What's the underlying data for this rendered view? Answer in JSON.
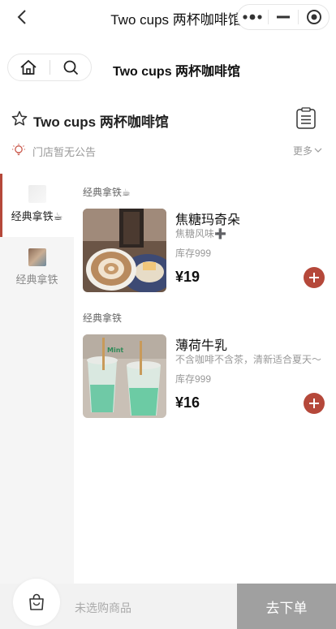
{
  "navbar": {
    "title": "Two cups 两杯咖啡馆"
  },
  "subheader": {
    "title": "Two cups 两杯咖啡馆"
  },
  "store": {
    "name": "Two cups 两杯咖啡馆",
    "notice": "门店暂无公告",
    "more_label": "更多"
  },
  "sidebar": {
    "items": [
      {
        "label": "经典拿铁☕",
        "active": true
      },
      {
        "label": "经典拿铁",
        "active": false
      }
    ]
  },
  "sections": [
    {
      "title": "经典拿铁☕",
      "product": {
        "name": "焦糖玛奇朵",
        "desc": "焦糖风味➕",
        "stock": "库存999",
        "price": "¥19"
      }
    },
    {
      "title": "经典拿铁",
      "product": {
        "name": "薄荷牛乳",
        "desc": "不含咖啡不含茶，清新适合夏天～",
        "stock": "库存999",
        "price": "¥16",
        "image_text": "Mint"
      }
    }
  ],
  "cart": {
    "empty_text": "未选购商品",
    "checkout_label": "去下单"
  },
  "colors": {
    "accent": "#b5483a",
    "checkout_bg": "#a0a0a0",
    "sidebar_bg": "#f5f5f5"
  }
}
